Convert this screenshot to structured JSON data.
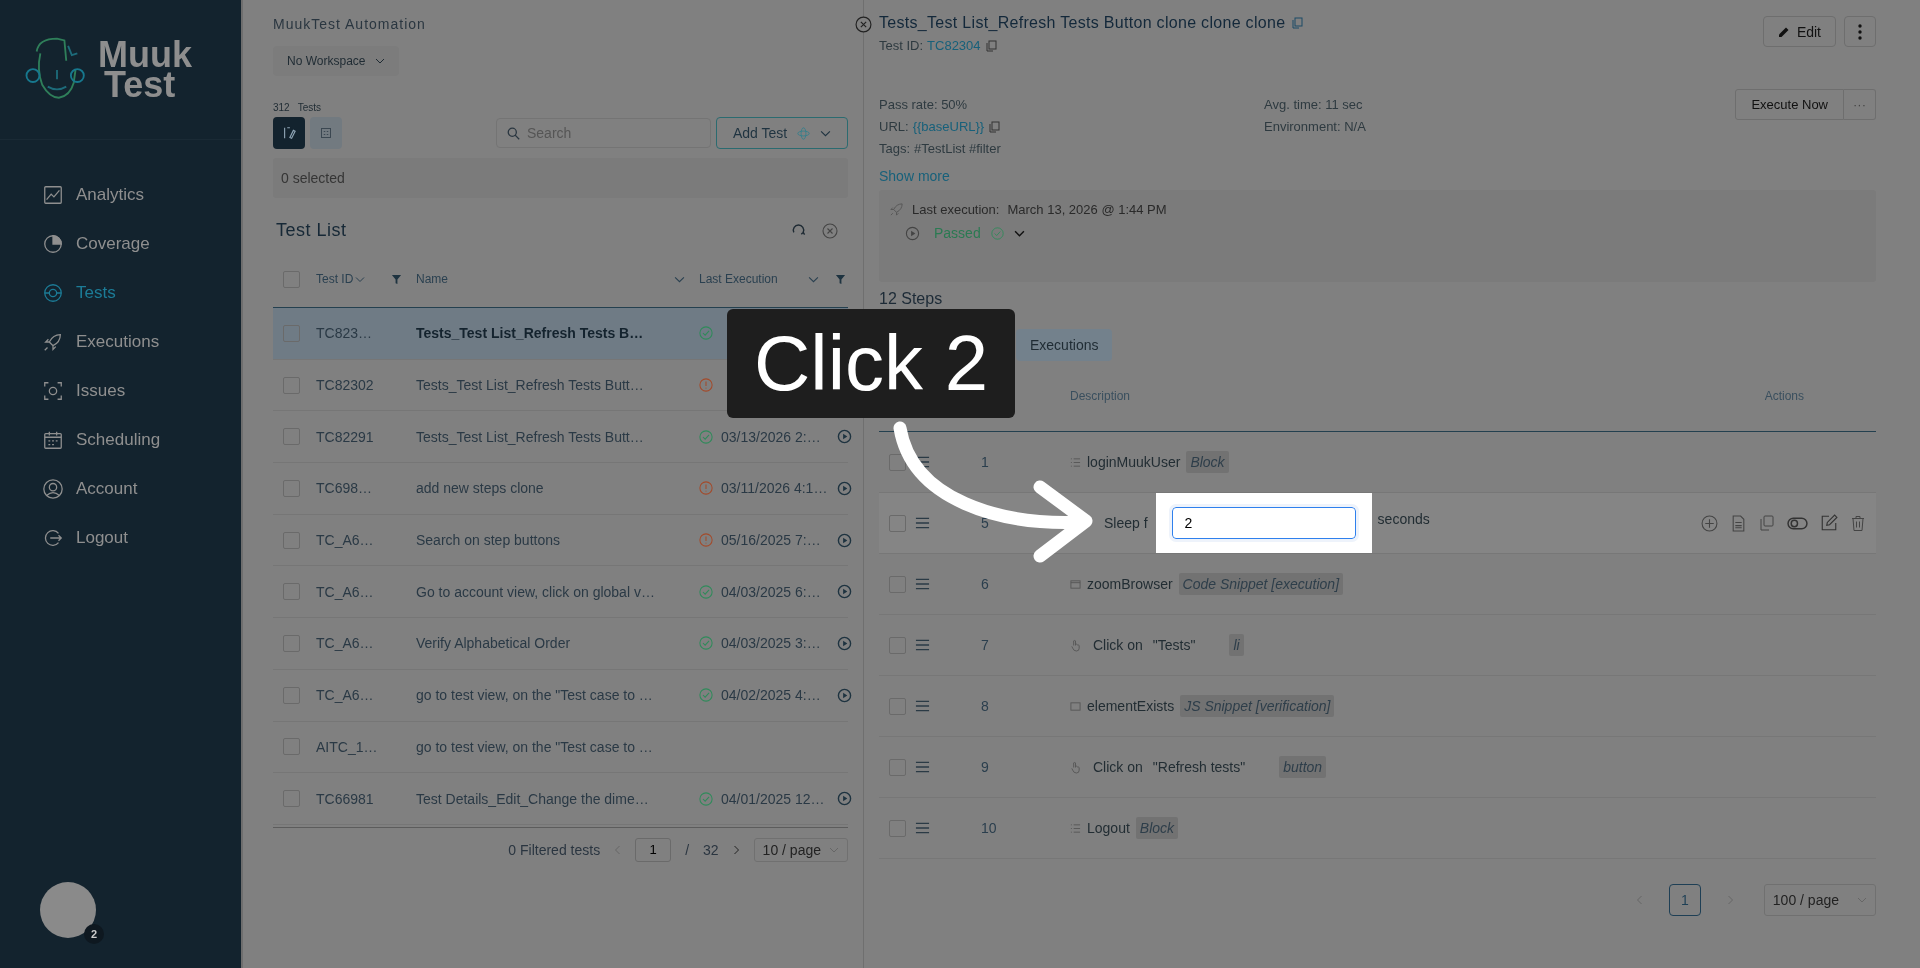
{
  "sidebar": {
    "logo": {
      "line1": "Muuk",
      "line2": "Test"
    },
    "items": [
      {
        "label": "Analytics",
        "selected": false
      },
      {
        "label": "Coverage",
        "selected": false
      },
      {
        "label": "Tests",
        "selected": true
      },
      {
        "label": "Executions",
        "selected": false
      },
      {
        "label": "Issues",
        "selected": false
      },
      {
        "label": "Scheduling",
        "selected": false
      },
      {
        "label": "Account",
        "selected": false
      },
      {
        "label": "Logout",
        "selected": false
      }
    ],
    "avatar_badge": "2"
  },
  "workspace": {
    "org": "MuukTest Automation",
    "dropdown": "No Workspace"
  },
  "tests": {
    "count": "312",
    "count_label": "Tests",
    "views": [
      {
        "kind": "builder",
        "selected": true
      },
      {
        "kind": "grid",
        "selected": false
      }
    ],
    "search": {
      "placeholder": "Search"
    },
    "add_button": "Add Test",
    "selection": "0 selected",
    "title": "Test List",
    "columns": [
      "Test ID",
      "Name",
      "Last Execution"
    ],
    "select_all": {
      "checked": false
    },
    "rows": [
      {
        "id": "TC823…",
        "name": "Tests_Test List_Refresh Tests B…",
        "passed": true,
        "checked": false,
        "selected": true
      },
      {
        "id": "TC82302",
        "name": "Tests_Test List_Refresh Tests Butt…",
        "passed": false,
        "checked": false,
        "selected": false
      },
      {
        "id": "TC82291",
        "name": "Tests_Test List_Refresh Tests Butt…",
        "passed": true,
        "date": "03/13/2026 2:…",
        "checked": false,
        "selected": false
      },
      {
        "id": "TC698…",
        "name": "add new steps clone",
        "passed": false,
        "date": "03/11/2026 4:1…",
        "checked": false,
        "selected": false
      },
      {
        "id": "TC_A6…",
        "name": "Search on step buttons",
        "passed": false,
        "date": "05/16/2025 7:…",
        "checked": false,
        "selected": false
      },
      {
        "id": "TC_A6…",
        "name": "Go to account view, click on global v…",
        "passed": true,
        "date": "04/03/2025 6:…",
        "checked": false,
        "selected": false
      },
      {
        "id": "TC_A6…",
        "name": "Verify Alphabetical Order",
        "passed": true,
        "date": "04/03/2025 3:…",
        "checked": false,
        "selected": false
      },
      {
        "id": "TC_A6…",
        "name": "go to test view, on the \"Test case to …",
        "passed": true,
        "date": "04/02/2025 4:…",
        "checked": false,
        "selected": false
      },
      {
        "id": "AITC_1…",
        "name": "go to test view, on the \"Test case to …",
        "checked": false,
        "selected": false
      },
      {
        "id": "TC66981",
        "name": "Test Details_Edit_Change the dime…",
        "passed": true,
        "date": "04/01/2025 12…",
        "checked": false,
        "selected": false
      }
    ],
    "pagination": {
      "summary": "0 Filtered tests",
      "page": "1",
      "separator": "/",
      "total": "32",
      "page_size": "10 / page"
    }
  },
  "detail": {
    "title": "Tests_Test List_Refresh Tests Button clone clone clone",
    "test_id_label": "Test ID:",
    "test_id": "TC82304",
    "edit_button": "Edit",
    "pass_rate": "Pass rate: 50%",
    "url_label": "URL:",
    "url": "{{baseURL}}",
    "tags_label": "Tags:",
    "tags": "#TestList #filter",
    "avg_time": "Avg. time: 11 sec",
    "environment": "Environment: N/A",
    "show_more": "Show more",
    "execute_button": "Execute Now",
    "execute_more": "···",
    "last_execution": {
      "label": "Last execution:",
      "date": "March 13, 2026 @ 1:44 PM",
      "status": "Passed"
    },
    "steps_title": "12 Steps",
    "toolbar_button": "Executions",
    "columns": [
      "Description",
      "Actions"
    ],
    "steps": [
      {
        "step": "1",
        "kind": "block",
        "name": "loginMuukUser",
        "tag": "Block",
        "checked": false,
        "hovered": false
      },
      {
        "step": "5",
        "kind": "sleep",
        "name": "Sleep f",
        "value": "2",
        "suffix": "seconds",
        "checked": false,
        "hovered": true
      },
      {
        "step": "6",
        "kind": "snippet",
        "name": "zoomBrowser",
        "tag": "Code Snippet [execution]",
        "checked": false,
        "hovered": false
      },
      {
        "step": "7",
        "kind": "click",
        "name": "Click on",
        "target": "\"Tests\"",
        "tag": "li",
        "checked": false,
        "hovered": false
      },
      {
        "step": "8",
        "kind": "check",
        "name": "elementExists",
        "tag": "JS Snippet [verification]",
        "checked": false,
        "hovered": false
      },
      {
        "step": "9",
        "kind": "click",
        "name": "Click on",
        "target": "\"Refresh tests\"",
        "tag": "button",
        "checked": false,
        "hovered": false
      },
      {
        "step": "10",
        "kind": "block",
        "name": "Logout",
        "tag": "Block",
        "checked": false,
        "hovered": false
      }
    ],
    "pagination": {
      "page": "1",
      "page_size": "100 / page"
    }
  },
  "tutorial": {
    "callout": "Click 2"
  }
}
